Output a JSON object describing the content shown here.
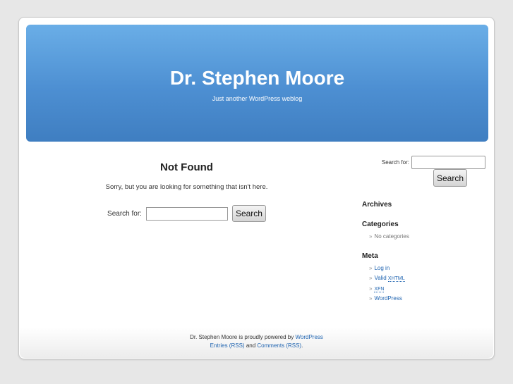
{
  "header": {
    "title": "Dr. Stephen Moore",
    "description": "Just another WordPress weblog"
  },
  "content": {
    "heading": "Not Found",
    "message": "Sorry, but you are looking for something that isn't here.",
    "search_label": "Search for:",
    "search_value": "",
    "search_button": "Search"
  },
  "sidebar": {
    "search_label": "Search for:",
    "search_value": "",
    "search_button": "Search",
    "archives_heading": "Archives",
    "categories_heading": "Categories",
    "categories_empty": "No categories",
    "meta_heading": "Meta",
    "meta_links": {
      "login": "Log in",
      "valid_prefix": "Valid",
      "xhtml": "XHTML",
      "xfn": "XFN",
      "wordpress": "WordPress"
    },
    "bullet": "»"
  },
  "footer": {
    "powered_text": "Dr. Stephen Moore is proudly powered by",
    "wordpress_link": "WordPress",
    "entries_link": "Entries (RSS)",
    "and_text": "and",
    "comments_link": "Comments (RSS)",
    "period": "."
  },
  "colors": {
    "header_top": "#6aaee7",
    "header_bottom": "#3f7ec1",
    "link": "#1e63b0",
    "background": "#e7e7e7"
  }
}
